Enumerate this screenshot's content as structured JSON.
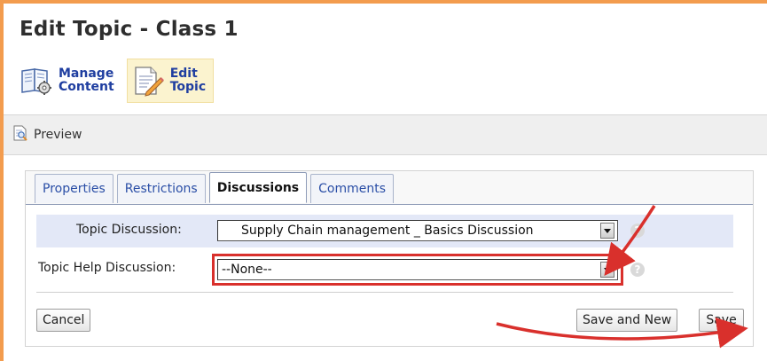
{
  "page": {
    "title": "Edit Topic - Class 1"
  },
  "toolbar": {
    "items": [
      {
        "label": "Manage\nContent",
        "icon": "book-gear-icon",
        "active": false
      },
      {
        "label": "Edit\nTopic",
        "icon": "document-pencil-icon",
        "active": true
      }
    ]
  },
  "preview": {
    "label": "Preview",
    "icon": "preview-page-icon"
  },
  "tabs": [
    {
      "label": "Properties",
      "active": false
    },
    {
      "label": "Restrictions",
      "active": false
    },
    {
      "label": "Discussions",
      "active": true
    },
    {
      "label": "Comments",
      "active": false
    }
  ],
  "form": {
    "topic_discussion": {
      "label": "Topic Discussion:",
      "value": "Supply Chain management _ Basics Discussion"
    },
    "topic_help_discussion": {
      "label": "Topic Help Discussion:",
      "value": "--None--"
    },
    "help_icon": "question-circle-icon"
  },
  "buttons": {
    "cancel": "Cancel",
    "save_and_new": "Save and New",
    "save": "Save"
  },
  "annotations": {
    "color": "#d9302c"
  },
  "colors": {
    "frame_border": "#f39c4e",
    "link_blue": "#1f3ea0",
    "active_tool_bg": "#fbf3cf",
    "row_highlight": "#e3e8f7"
  }
}
